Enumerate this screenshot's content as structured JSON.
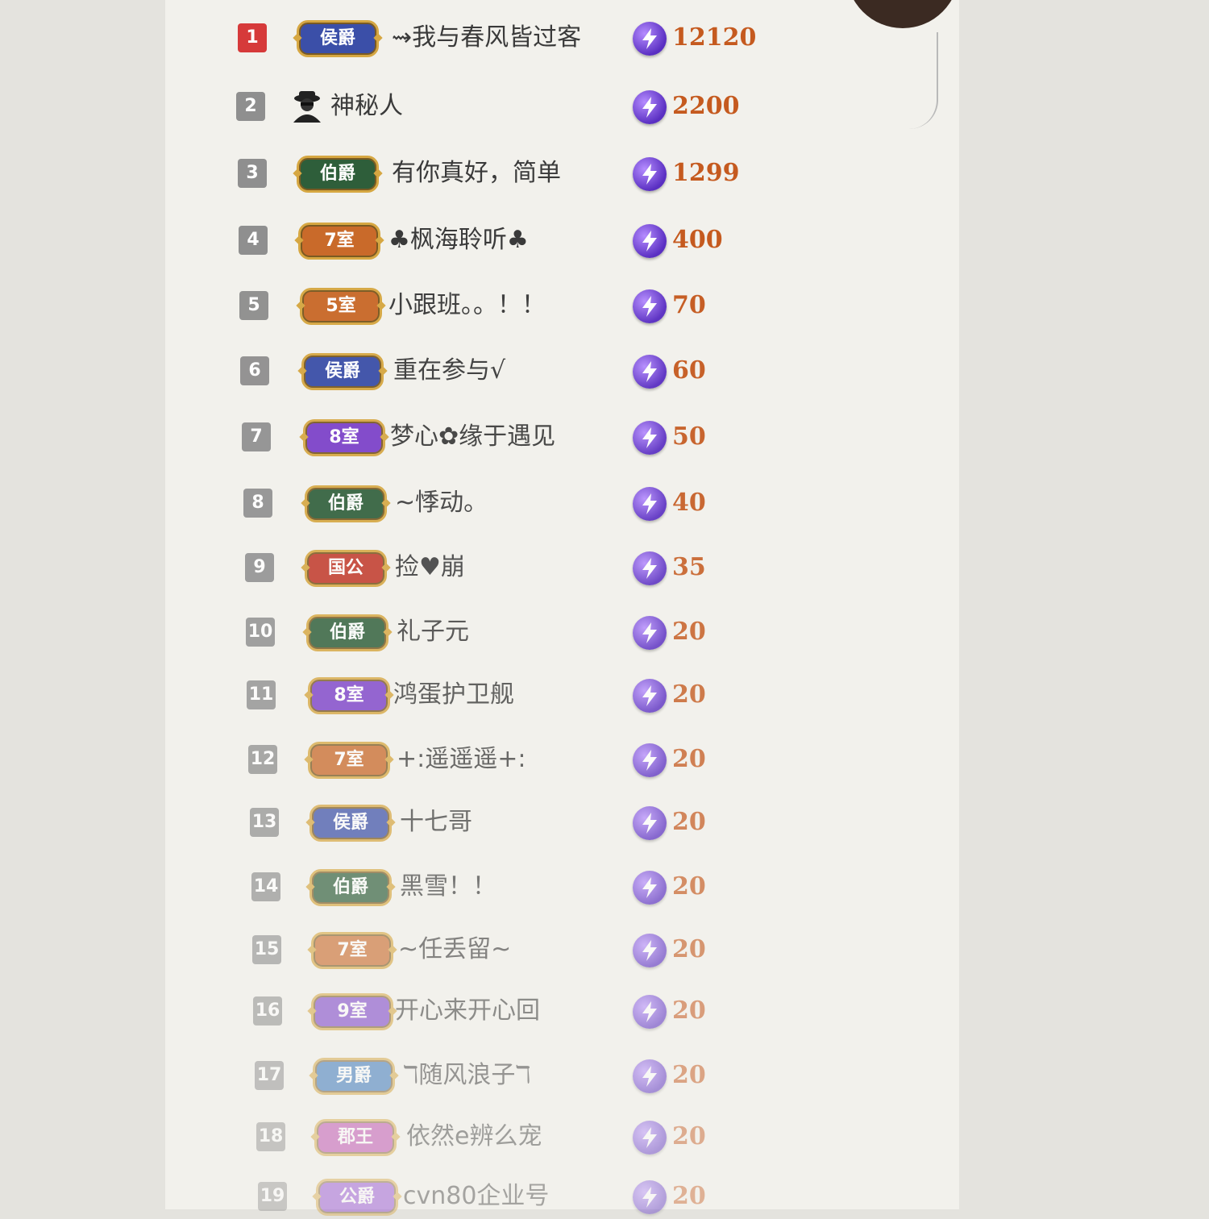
{
  "side_label": "",
  "rows": [
    {
      "rank": "1",
      "badge": "侯爵",
      "badge_color": "#3b4fa8",
      "name": "⇝我与春风皆过客",
      "score": "12120"
    },
    {
      "rank": "2",
      "badge": "",
      "badge_color": "",
      "name": "神秘人",
      "score": "2200",
      "avatar": "mystery-person"
    },
    {
      "rank": "3",
      "badge": "伯爵",
      "badge_color": "#2e5e3a",
      "name": "有你真好，简单",
      "score": "1299"
    },
    {
      "rank": "4",
      "badge": "7室",
      "badge_color": "#c96a2a",
      "name": "♣枫海聆听♣",
      "score": "400"
    },
    {
      "rank": "5",
      "badge": "5室",
      "badge_color": "#c96a2a",
      "name": "小跟班。。！！",
      "score": "70"
    },
    {
      "rank": "6",
      "badge": "侯爵",
      "badge_color": "#3b4fa8",
      "name": "重在参与√",
      "score": "60"
    },
    {
      "rank": "7",
      "badge": "8室",
      "badge_color": "#7a3fc9",
      "name": "梦心✿缘于遇见",
      "score": "50"
    },
    {
      "rank": "8",
      "badge": "伯爵",
      "badge_color": "#2e5e3a",
      "name": "~悸动。",
      "score": "40"
    },
    {
      "rank": "9",
      "badge": "国公",
      "badge_color": "#c23b2c",
      "name": "捡♥崩",
      "score": "35"
    },
    {
      "rank": "10",
      "badge": "伯爵",
      "badge_color": "#2e5e3a",
      "name": "礼子元",
      "score": "20"
    },
    {
      "rank": "11",
      "badge": "8室",
      "badge_color": "#7a3fc9",
      "name": "鸿蛋护卫舰",
      "score": "20"
    },
    {
      "rank": "12",
      "badge": "7室",
      "badge_color": "#c96a2a",
      "name": "+:遥遥遥+:",
      "score": "20"
    },
    {
      "rank": "13",
      "badge": "侯爵",
      "badge_color": "#3b4fa8",
      "name": "十七哥",
      "score": "20"
    },
    {
      "rank": "14",
      "badge": "伯爵",
      "badge_color": "#2e5e3a",
      "name": "黑雪！！",
      "score": "20"
    },
    {
      "rank": "15",
      "badge": "7室",
      "badge_color": "#c96a2a",
      "name": "~任丢留~",
      "score": "20"
    },
    {
      "rank": "16",
      "badge": "9室",
      "badge_color": "#7a3fc9",
      "name": "开心来开心回",
      "score": "20"
    },
    {
      "rank": "17",
      "badge": "男爵",
      "badge_color": "#2f6fb8",
      "name": "ℸ随风浪子ℸ",
      "score": "20"
    },
    {
      "rank": "18",
      "badge": "郡王",
      "badge_color": "#b83aa8",
      "name": "依然e辨么宠",
      "score": "20"
    },
    {
      "rank": "19",
      "badge": "公爵",
      "badge_color": "#8a3fd0",
      "name": "cvn80企业号",
      "score": "20"
    }
  ]
}
